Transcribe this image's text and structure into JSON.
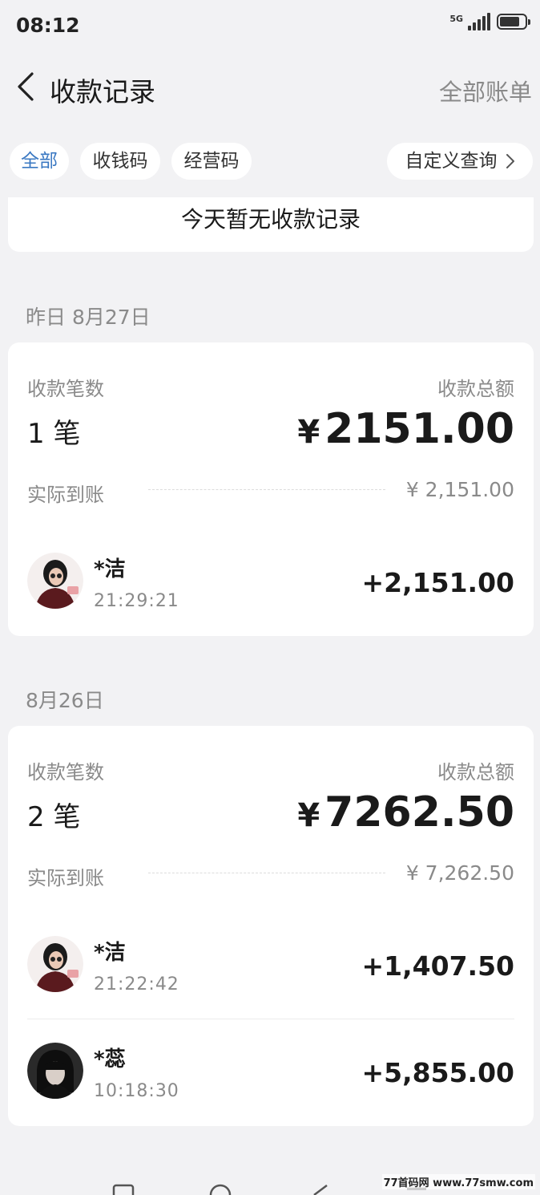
{
  "status_bar": {
    "time": "08:12",
    "network": "5G"
  },
  "header": {
    "title": "收款记录",
    "right_action": "全部账单"
  },
  "filters": {
    "chips": [
      "全部",
      "收钱码",
      "经营码"
    ],
    "custom_query": "自定义查询"
  },
  "today": {
    "empty_text": "今天暂无收款记录"
  },
  "groups": [
    {
      "date_label": "昨日 8月27日",
      "count_label": "收款笔数",
      "total_label": "收款总额",
      "count": "1 笔",
      "currency": "¥",
      "total": "2151.00",
      "actual_label": "实际到账",
      "actual_value": "¥ 2,151.00",
      "payments": [
        {
          "name": "*洁",
          "time": "21:29:21",
          "amount": "+2,151.00"
        }
      ]
    },
    {
      "date_label": "8月26日",
      "count_label": "收款笔数",
      "total_label": "收款总额",
      "count": "2 笔",
      "currency": "¥",
      "total": "7262.50",
      "actual_label": "实际到账",
      "actual_value": "¥ 7,262.50",
      "payments": [
        {
          "name": "*洁",
          "time": "21:22:42",
          "amount": "+1,407.50"
        },
        {
          "name": "*蕊",
          "time": "10:18:30",
          "amount": "+5,855.00"
        }
      ]
    }
  ],
  "watermark": "77首码网 www.77smw.com",
  "colors": {
    "accent": "#3a78c2",
    "background": "#f2f2f4",
    "card": "#ffffff",
    "secondary_text": "#8a8a8a"
  }
}
